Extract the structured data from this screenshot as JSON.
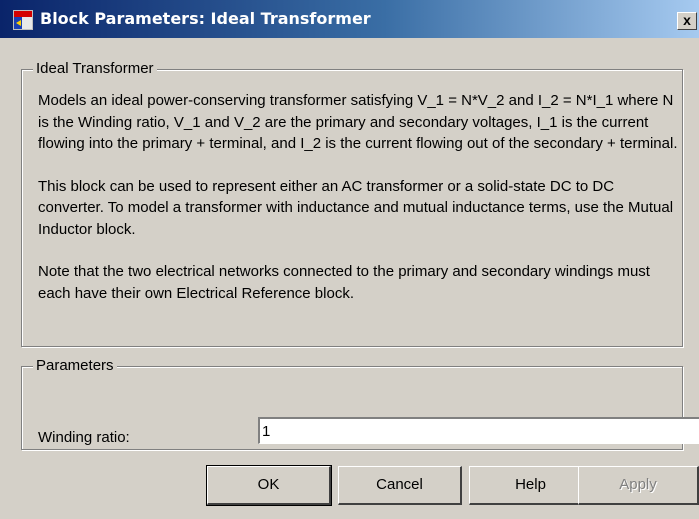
{
  "window": {
    "title": "Block Parameters: Ideal Transformer",
    "close_label": "x"
  },
  "description_group": {
    "legend": "Ideal Transformer",
    "paragraphs": [
      "Models an ideal power-conserving transformer satisfying V_1 = N*V_2 and I_2 = N*I_1 where N is the Winding ratio, V_1 and V_2 are the primary and secondary voltages, I_1 is the current flowing into the primary + terminal, and I_2 is the current flowing out of the secondary + terminal.",
      "This block can be used to represent either an AC transformer or a solid-state DC to DC converter. To model a transformer with inductance and mutual inductance terms, use the Mutual Inductor block.",
      "Note that the two electrical networks connected to the primary and secondary windings must each have their own Electrical Reference block."
    ]
  },
  "parameters_group": {
    "legend": "Parameters",
    "winding_ratio_label": "Winding ratio:",
    "winding_ratio_value": "1"
  },
  "buttons": {
    "ok": "OK",
    "cancel": "Cancel",
    "help": "Help",
    "apply": "Apply"
  },
  "icons": {
    "app": "simulink-block-icon",
    "close": "close-icon"
  }
}
